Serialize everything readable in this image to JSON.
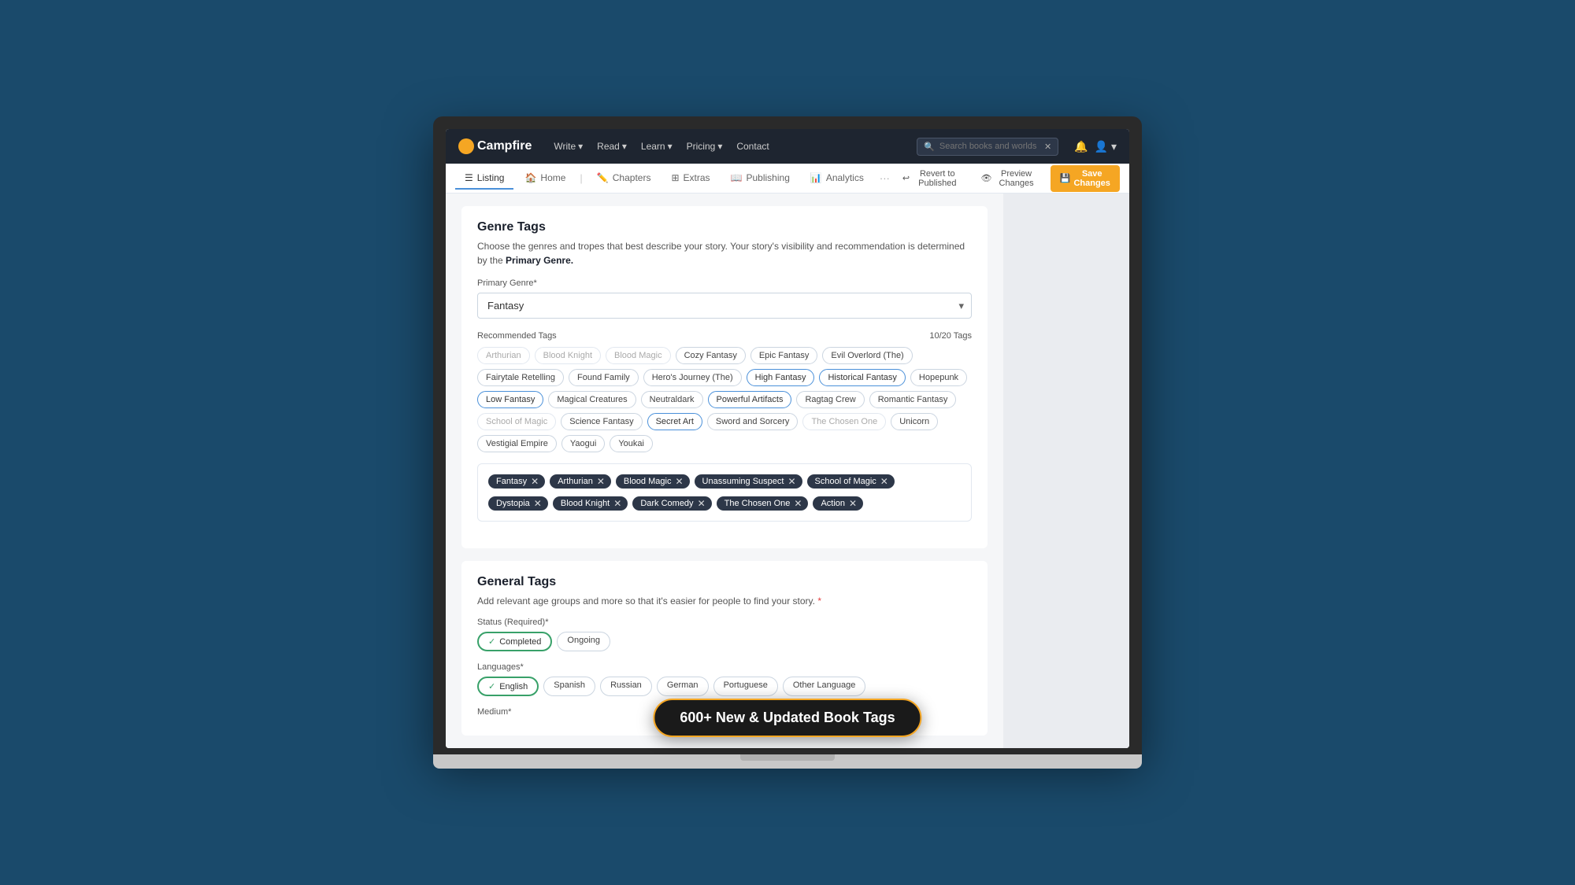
{
  "navbar": {
    "logo": "Campfire",
    "links": [
      {
        "label": "Write",
        "dropdown": true
      },
      {
        "label": "Read",
        "dropdown": true
      },
      {
        "label": "Learn",
        "dropdown": true
      },
      {
        "label": "Pricing",
        "dropdown": true
      },
      {
        "label": "Contact",
        "dropdown": false
      }
    ],
    "search_placeholder": "Search books and worlds",
    "notification_icon": "bell",
    "user_icon": "user"
  },
  "tabs": [
    {
      "label": "Listing",
      "icon": "list",
      "active": true
    },
    {
      "label": "Home",
      "icon": "home",
      "active": false
    },
    {
      "label": "Chapters",
      "icon": "pencil",
      "active": false
    },
    {
      "label": "Extras",
      "icon": "grid",
      "active": false
    },
    {
      "label": "Publishing",
      "icon": "book",
      "active": false
    },
    {
      "label": "Analytics",
      "icon": "chart",
      "active": false
    }
  ],
  "actions": {
    "revert": "Revert to Published",
    "preview": "Preview Changes",
    "save": "Save Changes"
  },
  "genre_tags": {
    "title": "Genre Tags",
    "description": "Choose the genres and tropes that best describe your story. Your story's visibility and recommendation is determined by the",
    "primary_genre_label": "Primary Genre*",
    "primary_genre_value": "Fantasy",
    "recommended_tags_label": "Recommended Tags",
    "tags_count": "10/20 Tags",
    "recommended_tags": [
      {
        "label": "Arthurian",
        "state": "muted"
      },
      {
        "label": "Blood Knight",
        "state": "muted"
      },
      {
        "label": "Blood Magic",
        "state": "muted"
      },
      {
        "label": "Cozy Fantasy",
        "state": "default"
      },
      {
        "label": "Epic Fantasy",
        "state": "default"
      },
      {
        "label": "Evil Overlord (The)",
        "state": "default"
      },
      {
        "label": "Fairytale Retelling",
        "state": "default"
      },
      {
        "label": "Found Family",
        "state": "default"
      },
      {
        "label": "Hero's Journey (The)",
        "state": "default"
      },
      {
        "label": "High Fantasy",
        "state": "highlighted"
      },
      {
        "label": "Historical Fantasy",
        "state": "highlighted"
      },
      {
        "label": "Hopepunk",
        "state": "default"
      },
      {
        "label": "Low Fantasy",
        "state": "highlighted"
      },
      {
        "label": "Magical Creatures",
        "state": "default"
      },
      {
        "label": "Neutraldark",
        "state": "default"
      },
      {
        "label": "Powerful Artifacts",
        "state": "highlighted"
      },
      {
        "label": "Ragtag Crew",
        "state": "default"
      },
      {
        "label": "Romantic Fantasy",
        "state": "default"
      },
      {
        "label": "School of Magic",
        "state": "muted"
      },
      {
        "label": "Science Fantasy",
        "state": "default"
      },
      {
        "label": "Secret Art",
        "state": "highlighted"
      },
      {
        "label": "Sword and Sorcery",
        "state": "default"
      },
      {
        "label": "The Chosen One",
        "state": "muted"
      },
      {
        "label": "Unicorn",
        "state": "default"
      },
      {
        "label": "Vestigial Empire",
        "state": "default"
      },
      {
        "label": "Yaogui",
        "state": "default"
      },
      {
        "label": "Youkai",
        "state": "default"
      }
    ],
    "selected_tags": [
      {
        "label": "Fantasy"
      },
      {
        "label": "Arthurian"
      },
      {
        "label": "Blood Magic"
      },
      {
        "label": "Unassuming Suspect"
      },
      {
        "label": "School of Magic"
      },
      {
        "label": "Dystopia"
      },
      {
        "label": "Blood Knight"
      },
      {
        "label": "Dark Comedy"
      },
      {
        "label": "The Chosen One"
      },
      {
        "label": "Action"
      }
    ]
  },
  "general_tags": {
    "title": "General Tags",
    "description": "Add relevant age groups and more so that it's easier for people to find your story.",
    "status_label": "Status (Required)*",
    "status_options": [
      {
        "label": "Completed",
        "active": true
      },
      {
        "label": "Ongoing",
        "active": false
      }
    ],
    "languages_label": "Languages*",
    "language_options": [
      {
        "label": "English",
        "active": true
      },
      {
        "label": "Spanish",
        "active": false
      },
      {
        "label": "Russian",
        "active": false
      },
      {
        "label": "German",
        "active": false
      },
      {
        "label": "Portuguese",
        "active": false
      },
      {
        "label": "Other Language",
        "active": false
      }
    ],
    "medium_label": "Medium*"
  },
  "promo": {
    "text": "600+ New & Updated Book Tags"
  }
}
